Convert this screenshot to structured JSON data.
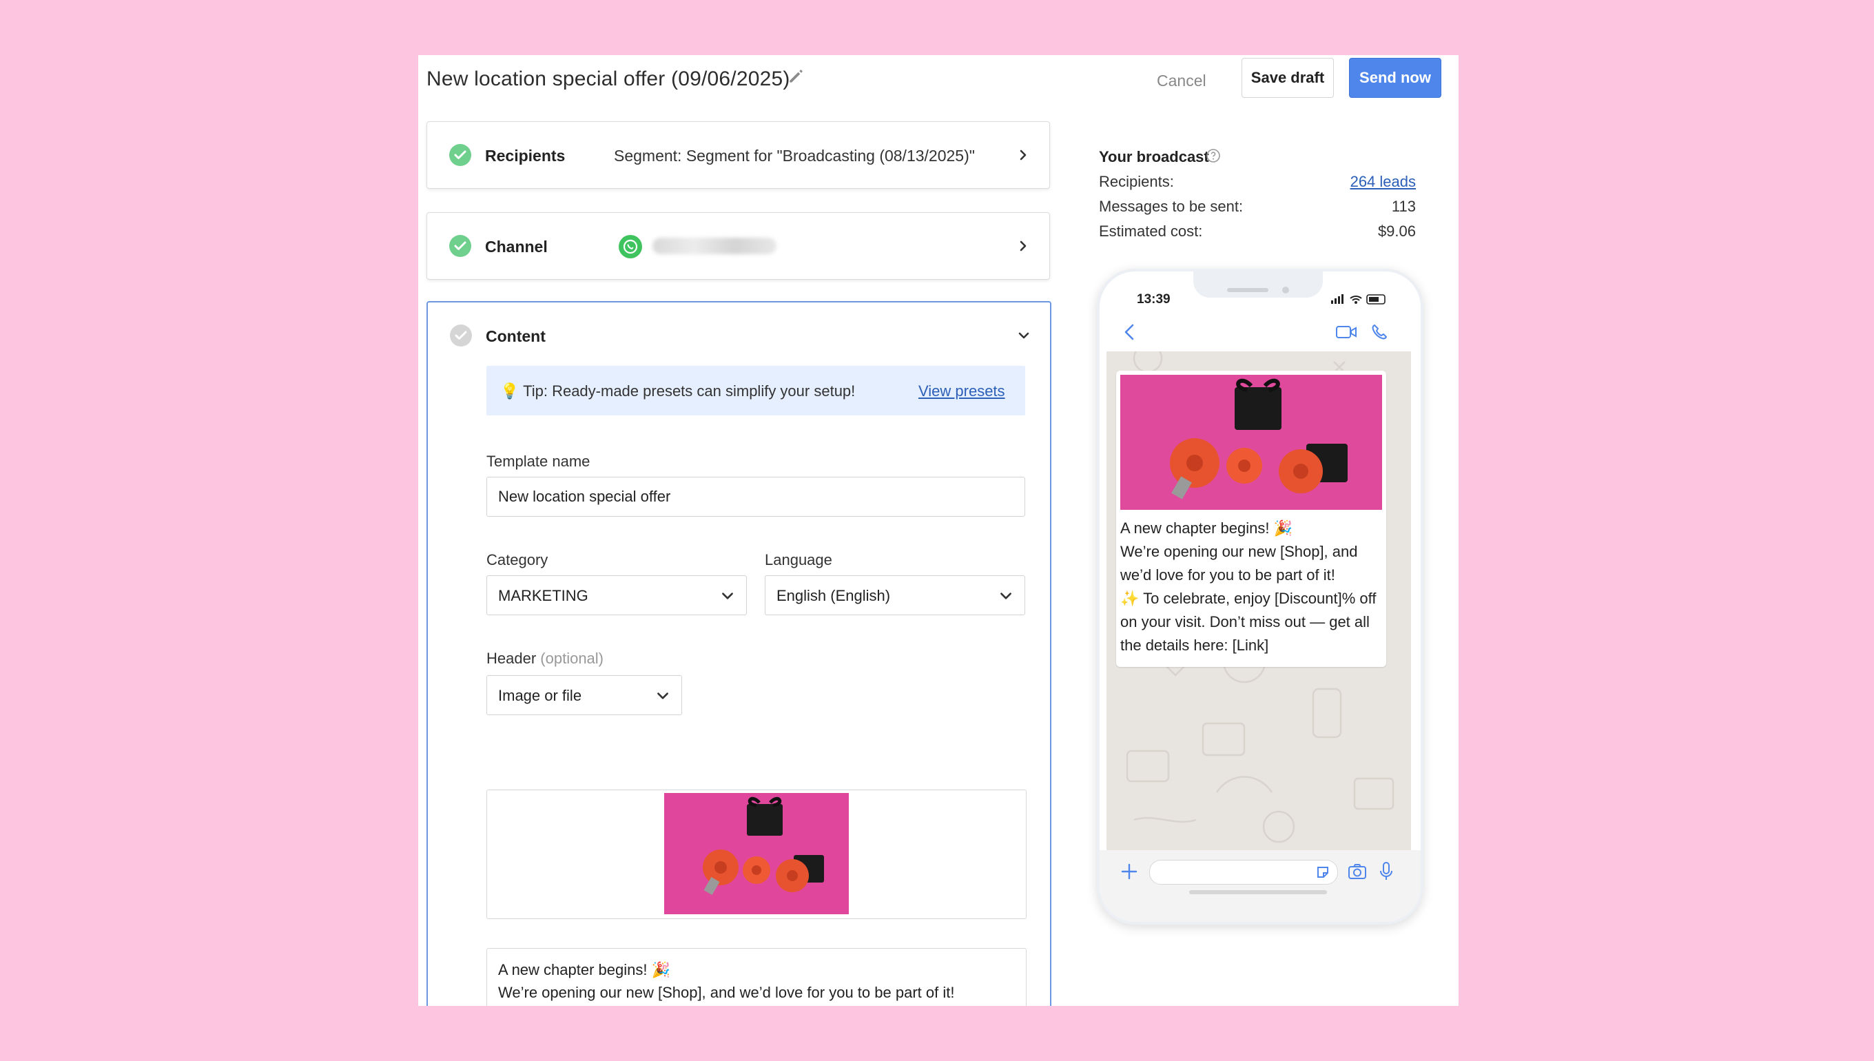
{
  "header": {
    "title": "New location special offer (09/06/2025)",
    "cancel_label": "Cancel",
    "save_draft_label": "Save draft",
    "send_now_label": "Send now"
  },
  "steps": {
    "recipients": {
      "label": "Recipients",
      "value": "Segment: Segment for \"Broadcasting (08/13/2025)\""
    },
    "channel": {
      "label": "Channel"
    },
    "content": {
      "label": "Content",
      "tip_text": "💡 Tip: Ready-made presets can simplify your setup!",
      "tip_link": "View presets",
      "template_name_label": "Template name",
      "template_name_value": "New location special offer",
      "category_label": "Category",
      "category_value": "MARKETING",
      "language_label": "Language",
      "language_value": "English (English)",
      "header_label": "Header",
      "header_optional": "(optional)",
      "header_value": "Image or file",
      "message": "A new chapter begins! 🎉\nWe’re opening our new [Shop], and we’d love for you to be part of it!\n✨ To celebrate, enjoy [Discount]% off on your visit. Don’t miss out — get all the details here: [Link]"
    }
  },
  "summary": {
    "title": "Your broadcast",
    "recipients_label": "Recipients:",
    "recipients_value": "264 leads",
    "messages_label": "Messages to be sent:",
    "messages_value": "113",
    "cost_label": "Estimated cost:",
    "cost_value": "$9.06"
  },
  "preview": {
    "time": "13:39",
    "message": "A new chapter begins! 🎉\nWe’re opening our new [Shop], and we’d love for you to be part of it!\n✨ To celebrate, enjoy [Discount]% off on your visit. Don’t miss out — get all the details here: [Link]"
  },
  "colors": {
    "background": "#fdc5df",
    "primary": "#4f86ec",
    "success": "#6fcf8d",
    "whatsapp": "#3fc35e",
    "gift_pink": "#e0479c"
  },
  "icons": [
    "pencil-icon",
    "check-icon",
    "chevron-right-icon",
    "chevron-down-icon",
    "whatsapp-icon",
    "help-icon",
    "back-icon",
    "video-icon",
    "phone-icon",
    "plus-icon",
    "sticker-icon",
    "camera-icon",
    "mic-icon"
  ]
}
